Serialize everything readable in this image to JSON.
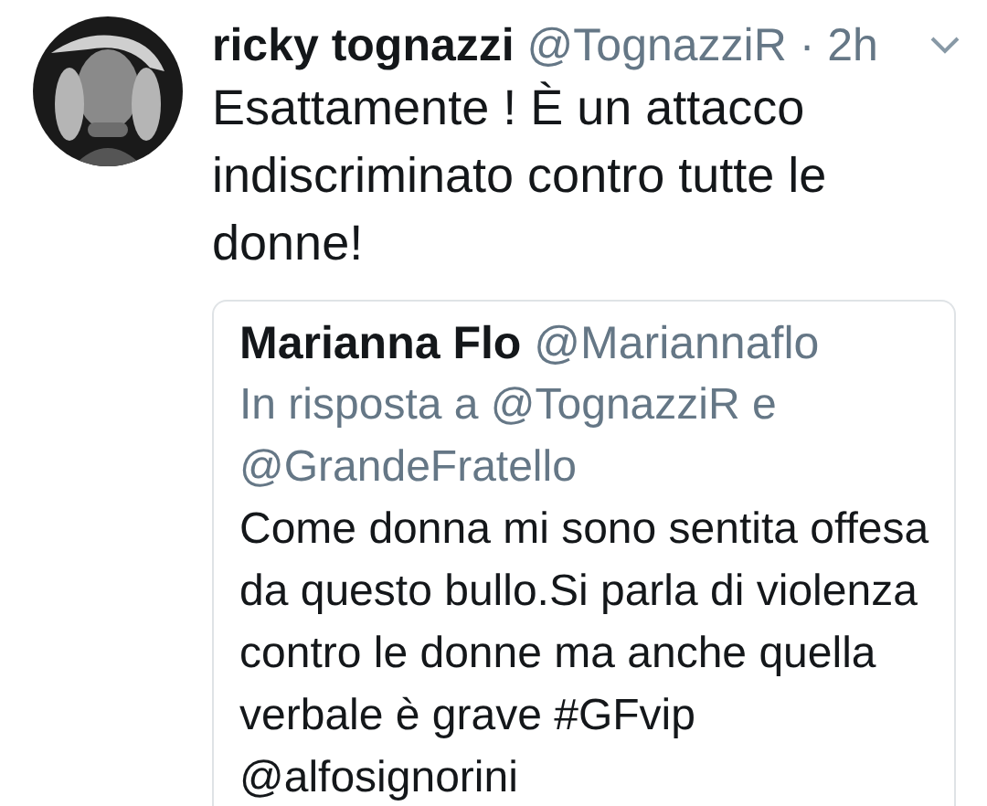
{
  "tweet": {
    "author_name": "ricky tognazzi",
    "handle": "@TognazziR",
    "time": "· 2h",
    "text": "Esattamente ! È un attacco indiscriminato contro tutte le donne!",
    "quoted": {
      "author_name": "Marianna Flo",
      "handle": "@Mariannaflo",
      "reply_to": "In risposta a @TognazziR e @GrandeFratello",
      "text": "Come donna mi sono sentita offesa da questo bullo.Si parla di violenza contro le donne ma anche quella verbale è grave #GFvip @alfosignorini"
    }
  }
}
